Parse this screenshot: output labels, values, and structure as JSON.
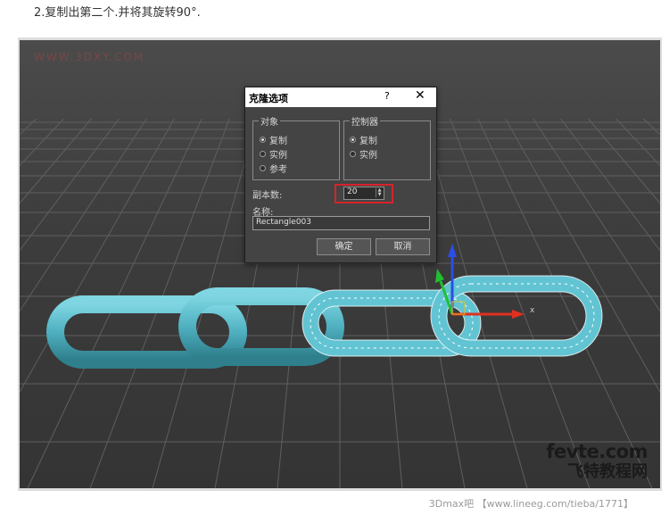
{
  "page": {
    "step_title": "2.复制出第二个.并将其旋转90°."
  },
  "watermarks": {
    "top_left": "WWW.3DXY.COM",
    "logo_line1": "fevte.com",
    "logo_line2": "飞特教程网",
    "credit": "3Dmax吧 【www.lineeg.com/tieba/1771】"
  },
  "viewport": {
    "background_color": "#3c3c3c",
    "grid_color": "#5f5f5f",
    "solid_link_color": "#4fb0c0",
    "wire_link_color": "#62c4d3",
    "gizmo": {
      "x_color": "#e03020",
      "y_color": "#20c030",
      "z_color": "#2a4ee6",
      "x_label": "x"
    }
  },
  "dialog": {
    "title": "克隆选项",
    "help_icon": "?",
    "close_icon": "✕",
    "object_group": {
      "legend": "对象",
      "options": [
        {
          "label": "复制",
          "selected": true
        },
        {
          "label": "实例",
          "selected": false
        },
        {
          "label": "参考",
          "selected": false
        }
      ]
    },
    "controller_group": {
      "legend": "控制器",
      "options": [
        {
          "label": "复制",
          "selected": true
        },
        {
          "label": "实例",
          "selected": false
        }
      ]
    },
    "copies_label": "副本数:",
    "copies_value": "20",
    "name_label": "名称:",
    "name_value": "Rectangle003",
    "ok_label": "确定",
    "cancel_label": "取消",
    "highlight_color": "#d6232a"
  }
}
